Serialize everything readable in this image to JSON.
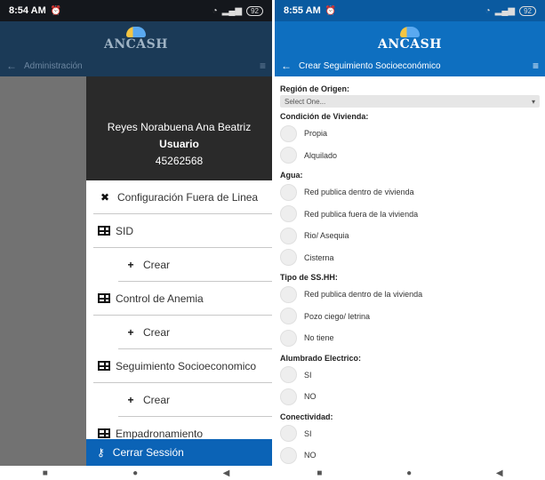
{
  "left": {
    "status": {
      "time": "8:54 AM",
      "battery": "92"
    },
    "header": {
      "brand": "ANCASH",
      "nav_title": "Administración"
    },
    "drawer": {
      "user_name": "Reyes Norabuena Ana Beatriz",
      "role": "Usuario",
      "user_id": "45262568"
    },
    "menu": [
      {
        "label": "Configuración Fuera de Linea",
        "icon": "tools-icon"
      },
      {
        "label": "SID",
        "icon": "table-icon"
      },
      {
        "label": "Crear",
        "icon": "plus-icon"
      },
      {
        "label": "Control de Anemia",
        "icon": "table-icon"
      },
      {
        "label": "Crear",
        "icon": "plus-icon"
      },
      {
        "label": "Seguimiento Socioeconomico",
        "icon": "table-icon"
      },
      {
        "label": "Crear",
        "icon": "plus-icon"
      },
      {
        "label": "Empadronamiento",
        "icon": "table-icon"
      }
    ],
    "logout_label": "Cerrar Sessión"
  },
  "right": {
    "status": {
      "time": "8:55 AM",
      "battery": "92"
    },
    "header": {
      "brand": "ANCASH",
      "nav_title": "Crear Seguimiento Socioeconómico"
    },
    "form": {
      "region_label": "Región de Origen:",
      "region_value": "Select One...",
      "groups": [
        {
          "label": "Condición de Vivienda:",
          "options": [
            "Propia",
            "Alquilado"
          ]
        },
        {
          "label": "Agua:",
          "options": [
            "Red publica dentro de vivienda",
            "Red publica fuera de la vivienda",
            "Rio/ Asequia",
            "Cisterna"
          ]
        },
        {
          "label": "Tipo de SS.HH:",
          "options": [
            "Red publica dentro de la vivienda",
            "Pozo ciego/ letrina",
            "No tiene"
          ]
        },
        {
          "label": "Alumbrado Electrico:",
          "options": [
            "SI",
            "NO"
          ]
        },
        {
          "label": "Conectividad:",
          "options": [
            "SI",
            "NO"
          ]
        }
      ]
    }
  }
}
